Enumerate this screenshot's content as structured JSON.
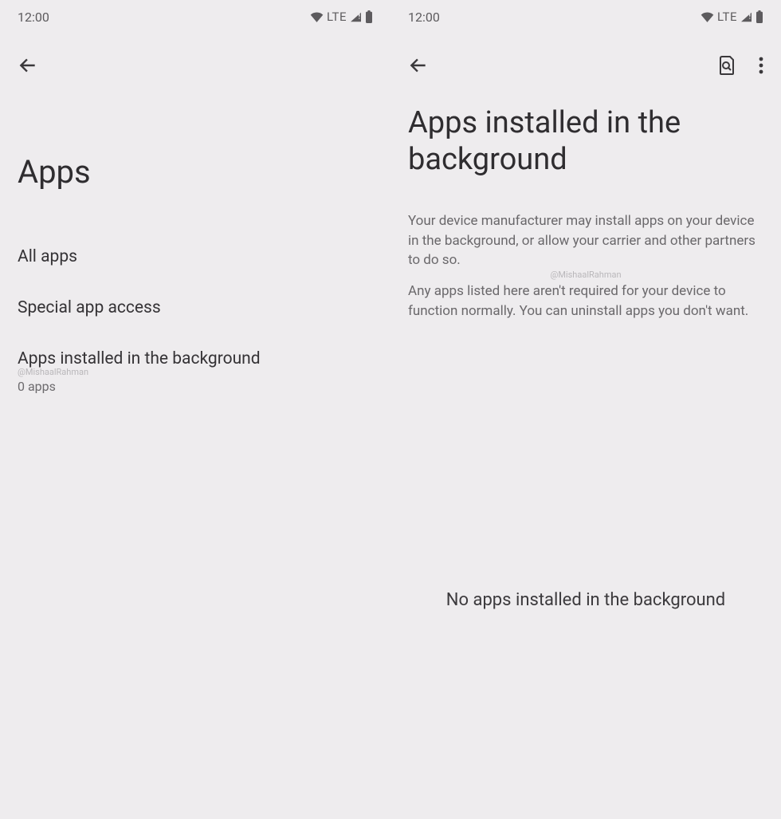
{
  "status": {
    "time": "12:00",
    "network": "LTE"
  },
  "left": {
    "title": "Apps",
    "items": [
      {
        "title": "All apps",
        "sub": ""
      },
      {
        "title": "Special app access",
        "sub": ""
      },
      {
        "title": "Apps installed in the background",
        "sub": "0 apps",
        "watermark": "@MishaalRahman"
      }
    ]
  },
  "right": {
    "title": "Apps installed in the background",
    "description1": "Your device manufacturer may install apps on your device in the background, or allow your carrier and other partners to do so.",
    "description2": "Any apps listed here aren't required for your device to function normally. You can uninstall apps you don't want.",
    "watermark": "@MishaalRahman",
    "empty": "No apps installed in the background"
  }
}
